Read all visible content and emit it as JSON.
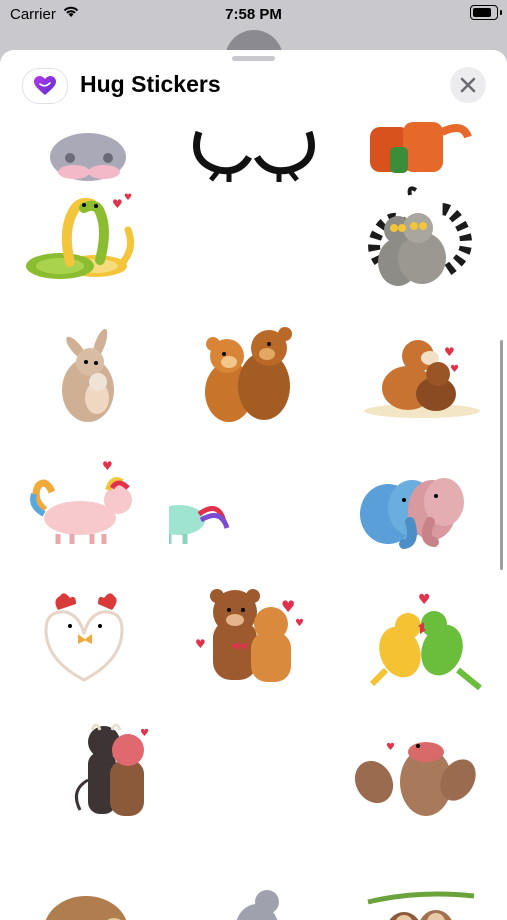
{
  "status_bar": {
    "carrier": "Carrier",
    "time": "7:58 PM"
  },
  "header": {
    "title": "Hug Stickers",
    "app_icon": "heart-icon",
    "close_icon": "close-icon"
  },
  "stickers": [
    {
      "name": "koalas-hug",
      "colors": [
        "#a9a9b7",
        "#f4b9c8"
      ]
    },
    {
      "name": "penguins-hug",
      "colors": [
        "#111111",
        "#ffffff"
      ]
    },
    {
      "name": "foxes-hug",
      "colors": [
        "#d8521e",
        "#3b8d3a"
      ]
    },
    {
      "name": "snakes-hug",
      "colors": [
        "#8cbc2f",
        "#f2c53b"
      ]
    },
    {
      "name": "empty",
      "colors": []
    },
    {
      "name": "lemurs-hug",
      "colors": [
        "#8e8c86",
        "#1b1b1b"
      ]
    },
    {
      "name": "rabbits-hug",
      "colors": [
        "#cfb095",
        "#f0d7c2"
      ]
    },
    {
      "name": "teddy-bears-hug",
      "colors": [
        "#c8742b",
        "#a35d22"
      ]
    },
    {
      "name": "dogs-hug",
      "colors": [
        "#c97333",
        "#f2e6c6"
      ]
    },
    {
      "name": "unicorns-hug",
      "colors": [
        "#f7c9cc",
        "#9fe4d0"
      ]
    },
    {
      "name": "empty",
      "colors": []
    },
    {
      "name": "elephants-hug",
      "colors": [
        "#5a9fd8",
        "#d99a9f"
      ]
    },
    {
      "name": "chickens-hug",
      "colors": [
        "#ffffff",
        "#d93b3b"
      ]
    },
    {
      "name": "brown-bears-hug",
      "colors": [
        "#9c5a2e",
        "#d98a3c"
      ]
    },
    {
      "name": "parrots-hug",
      "colors": [
        "#f5c234",
        "#6bbd3c"
      ]
    },
    {
      "name": "bulls-hug",
      "colors": [
        "#3d3535",
        "#e0686f"
      ]
    },
    {
      "name": "empty",
      "colors": []
    },
    {
      "name": "platypus-hug",
      "colors": [
        "#9b6b4f",
        "#d96a6a"
      ]
    },
    {
      "name": "hamsters-hug",
      "colors": [
        "#b07d4f",
        "#e8c79b"
      ]
    },
    {
      "name": "mice-hug",
      "colors": [
        "#9fa2ad",
        "#e3c2c5"
      ]
    },
    {
      "name": "sloths-hug",
      "colors": [
        "#8a5a3b",
        "#6aa33b"
      ]
    }
  ]
}
